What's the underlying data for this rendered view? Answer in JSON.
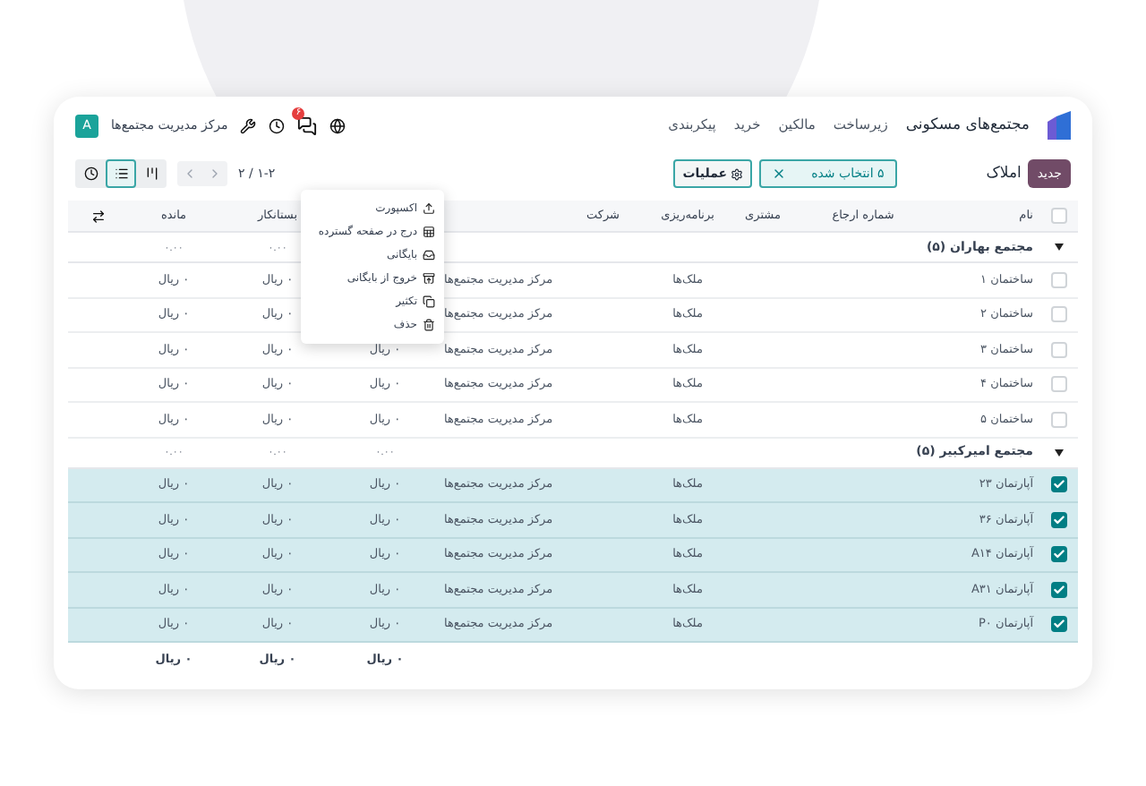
{
  "navbar": {
    "app_name": "مجتمع‌های مسکونی",
    "menu": [
      "زیرساخت",
      "مالکین",
      "خرید",
      "پیکربندی"
    ],
    "messages_badge": "۶",
    "company": "مرکز مدیریت مجتمع‌ها",
    "avatar": "A"
  },
  "control_panel": {
    "new_button": "جدید",
    "title": "املاک",
    "selection": "۵ انتخاب شده",
    "actions_button": "عملیات",
    "pager": "۲ / ۱-۲",
    "views": [
      {
        "kind": "kanban",
        "selected": false
      },
      {
        "kind": "list",
        "selected": true
      },
      {
        "kind": "activity",
        "selected": false
      }
    ]
  },
  "actions_menu": [
    {
      "kind": "export",
      "label": "اکسپورت"
    },
    {
      "kind": "spreadsheet",
      "label": "درج در صفحه گسترده"
    },
    {
      "kind": "archive",
      "label": "بایگانی"
    },
    {
      "kind": "unarchive",
      "label": "خروج از بایگانی"
    },
    {
      "kind": "duplicate",
      "label": "تکثیر"
    },
    {
      "kind": "delete",
      "label": "حذف"
    }
  ],
  "table": {
    "select_all": {
      "checked": false
    },
    "columns": {
      "name": "نام",
      "reference": "شماره ارجاع",
      "customer": "مشتری",
      "planning": "برنامه‌ریزی",
      "company": "شرکت",
      "credit": "بستانکار",
      "balance": "مانده"
    },
    "groups": [
      {
        "label": "مجتمع بهاران (۵)",
        "expanded": true,
        "totals": {
          "credit": "۰.۰۰",
          "balance": "۰.۰۰"
        },
        "rows": [
          {
            "selected": false,
            "name": "ساختمان ۱",
            "planning": "ملک‌ها",
            "company": "مرکز مدیریت مجتمع‌ها",
            "credit": "۰ ریال",
            "balance": "۰ ریال"
          },
          {
            "selected": false,
            "name": "ساختمان ۲",
            "planning": "ملک‌ها",
            "company": "مرکز مدیریت مجتمع‌ها",
            "credit": "۰ ریال",
            "balance": "۰ ریال"
          },
          {
            "selected": false,
            "name": "ساختمان ۳",
            "planning": "ملک‌ها",
            "company": "مرکز مدیریت مجتمع‌ها",
            "column_7": "۰ ریال",
            "credit": "۰ ریال",
            "balance": "۰ ریال"
          },
          {
            "selected": false,
            "name": "ساختمان ۴",
            "planning": "ملک‌ها",
            "company": "مرکز مدیریت مجتمع‌ها",
            "column_7": "۰ ریال",
            "credit": "۰ ریال",
            "balance": "۰ ریال"
          },
          {
            "selected": false,
            "name": "ساختمان ۵",
            "planning": "ملک‌ها",
            "company": "مرکز مدیریت مجتمع‌ها",
            "column_7": "۰ ریال",
            "credit": "۰ ریال",
            "balance": "۰ ریال"
          }
        ]
      },
      {
        "label": "مجتمع امیرکبیر (۵)",
        "expanded": true,
        "totals": {
          "column_7": "۰.۰۰",
          "credit": "۰.۰۰",
          "balance": "۰.۰۰"
        },
        "rows": [
          {
            "selected": true,
            "name": "آپارتمان ۲۳",
            "planning": "ملک‌ها",
            "company": "مرکز مدیریت مجتمع‌ها",
            "column_7": "۰ ریال",
            "credit": "۰ ریال",
            "balance": "۰ ریال"
          },
          {
            "selected": true,
            "name": "آپارتمان ۳۶",
            "planning": "ملک‌ها",
            "company": "مرکز مدیریت مجتمع‌ها",
            "column_7": "۰ ریال",
            "credit": "۰ ریال",
            "balance": "۰ ریال"
          },
          {
            "selected": true,
            "name": "آپارتمان A۱۴",
            "planning": "ملک‌ها",
            "company": "مرکز مدیریت مجتمع‌ها",
            "column_7": "۰ ریال",
            "credit": "۰ ریال",
            "balance": "۰ ریال"
          },
          {
            "selected": true,
            "name": "آپارتمان A۳۱",
            "planning": "ملک‌ها",
            "company": "مرکز مدیریت مجتمع‌ها",
            "column_7": "۰ ریال",
            "credit": "۰ ریال",
            "balance": "۰ ریال"
          },
          {
            "selected": true,
            "name": "آپارتمان P۰",
            "planning": "ملک‌ها",
            "company": "مرکز مدیریت مجتمع‌ها",
            "column_7": "۰ ریال",
            "credit": "۰ ریال",
            "balance": "۰ ریال"
          }
        ]
      }
    ],
    "footer": {
      "column_7": "۰ ریال",
      "credit": "۰ ریال",
      "balance": "۰ ریال"
    }
  }
}
